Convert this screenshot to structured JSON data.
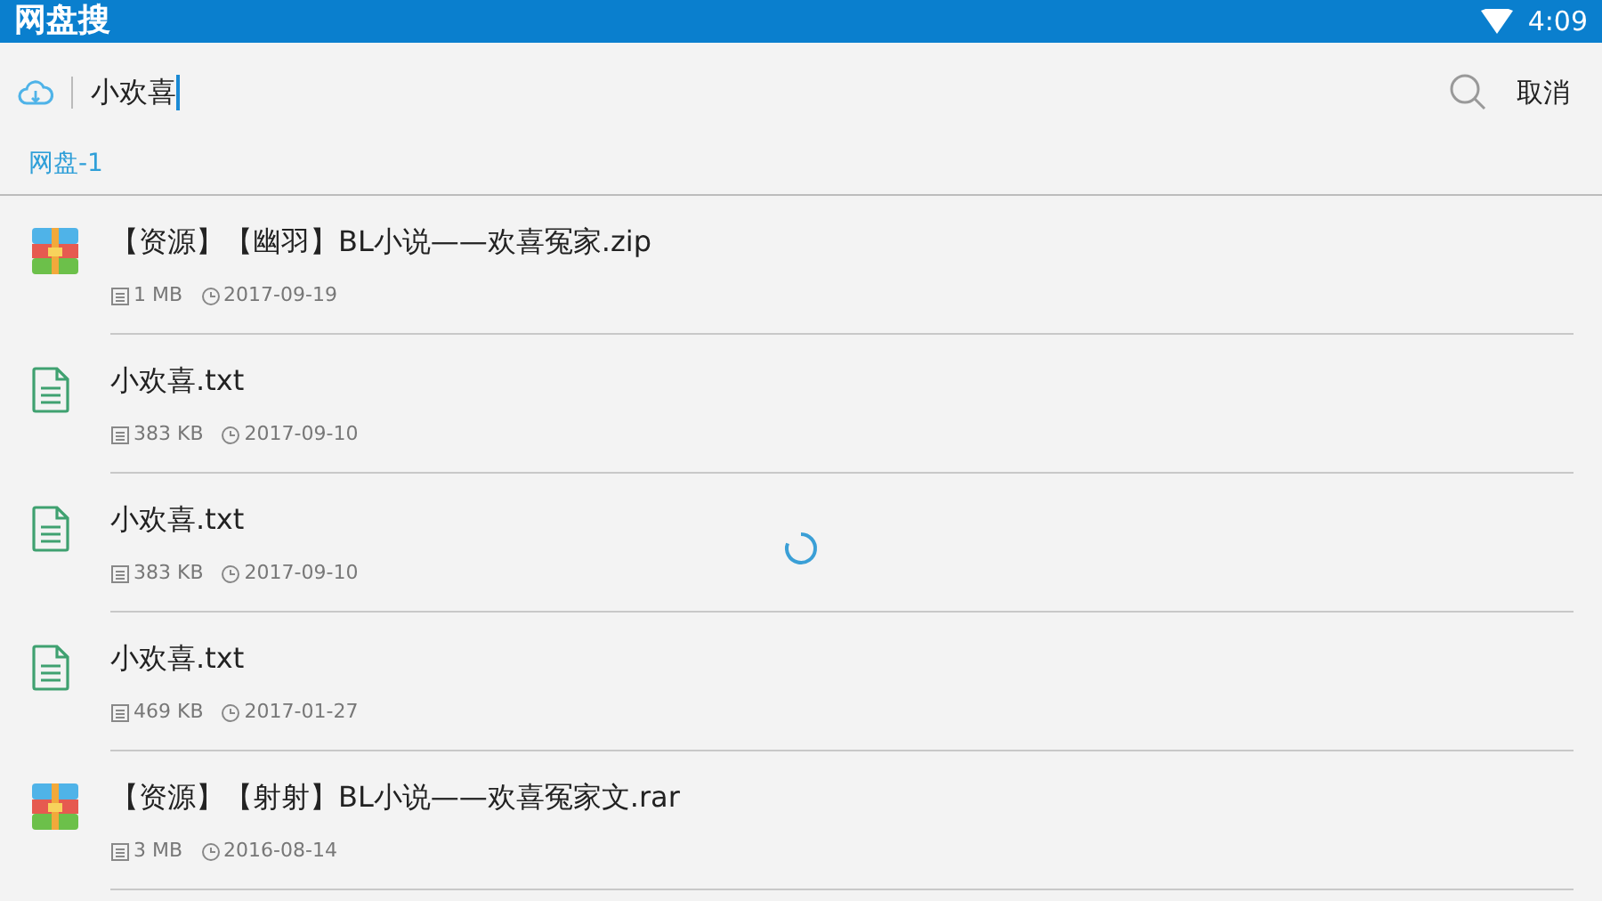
{
  "status_bar": {
    "title": "网盘搜",
    "time": "4:09"
  },
  "search": {
    "value": "小欢喜",
    "cancel": "取消"
  },
  "tabs": [
    {
      "label": "网盘-1",
      "selected": true
    }
  ],
  "files": [
    {
      "kind": "archive",
      "name": "【资源】【幽羽】BL小说——欢喜冤家.zip",
      "size": "1 MB",
      "date": "2017-09-19"
    },
    {
      "kind": "text",
      "name": "小欢喜.txt",
      "size": "383 KB",
      "date": "2017-09-10"
    },
    {
      "kind": "text",
      "name": "小欢喜.txt",
      "size": "383 KB",
      "date": "2017-09-10"
    },
    {
      "kind": "text",
      "name": "小欢喜.txt",
      "size": "469 KB",
      "date": "2017-01-27"
    },
    {
      "kind": "archive",
      "name": "【资源】【射射】BL小说——欢喜冤家文.rar",
      "size": "3 MB",
      "date": "2016-08-14"
    }
  ],
  "loading": true
}
